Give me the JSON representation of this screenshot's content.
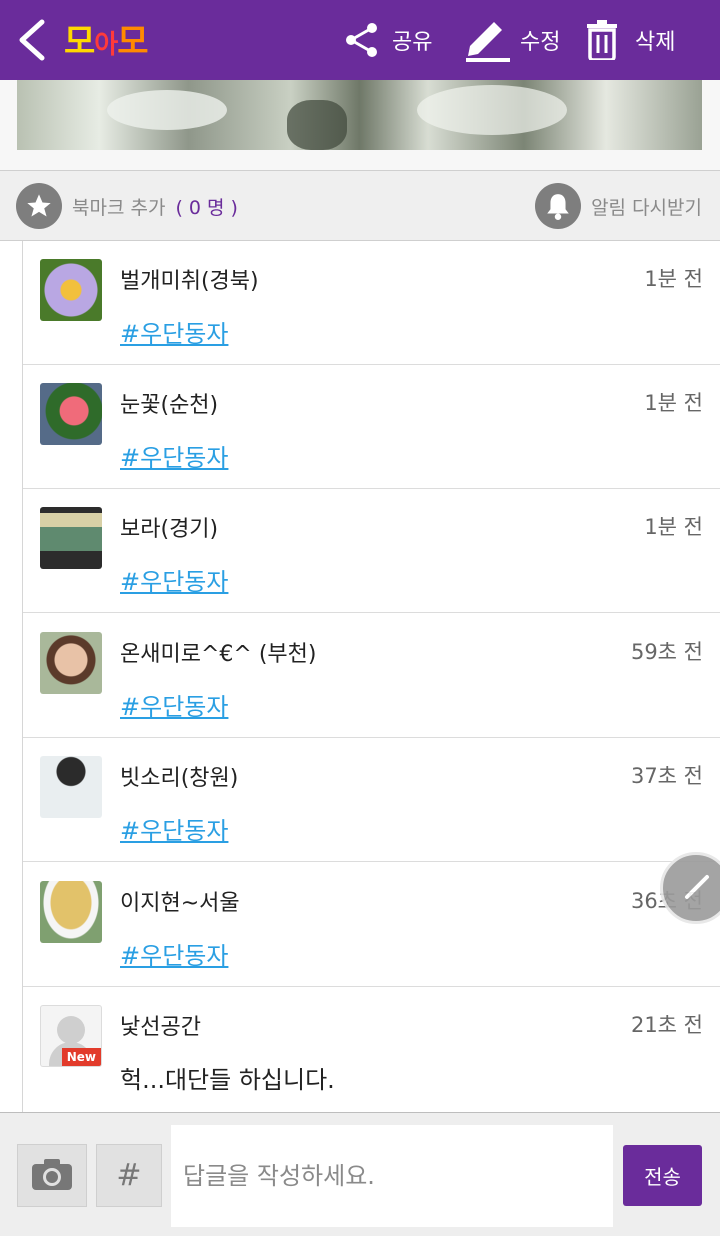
{
  "header": {
    "logo": [
      "모",
      "아",
      "모"
    ],
    "share_label": "공유",
    "edit_label": "수정",
    "delete_label": "삭제"
  },
  "bookmark": {
    "label": "북마크 추가",
    "count": "( 0 명 )",
    "notify_label": "알림 다시받기"
  },
  "comments": [
    {
      "author": "벌개미취(경북)",
      "time": "1분 전",
      "text": "#우단동자",
      "avatar": "aster-flower"
    },
    {
      "author": "눈꽃(순천)",
      "time": "1분 전",
      "text": "#우단동자",
      "avatar": "pink-flowers"
    },
    {
      "author": "보라(경기)",
      "time": "1분 전",
      "text": "#우단동자",
      "avatar": "painting"
    },
    {
      "author": "온새미로^€^  (부천)",
      "time": "59초 전",
      "text": "#우단동자",
      "avatar": "woman-glasses"
    },
    {
      "author": "빗소리(창원)",
      "time": "37초 전",
      "text": "#우단동자",
      "avatar": "spider-drawing"
    },
    {
      "author": "이지현~서울",
      "time": "36초 전",
      "text": "#우단동자",
      "avatar": "straw-hat"
    },
    {
      "author": "낯선공간",
      "time": "21초 전",
      "text": "헉...대단들 하십니다.",
      "avatar": "default-user",
      "badge": "New"
    }
  ],
  "reply": {
    "hash_label": "#",
    "placeholder": "답글을 작성하세요.",
    "send_label": "전송"
  },
  "colors": {
    "brand": "#6a2c9b",
    "tag_link": "#2a9fe3",
    "new_badge": "#e23b2b"
  }
}
